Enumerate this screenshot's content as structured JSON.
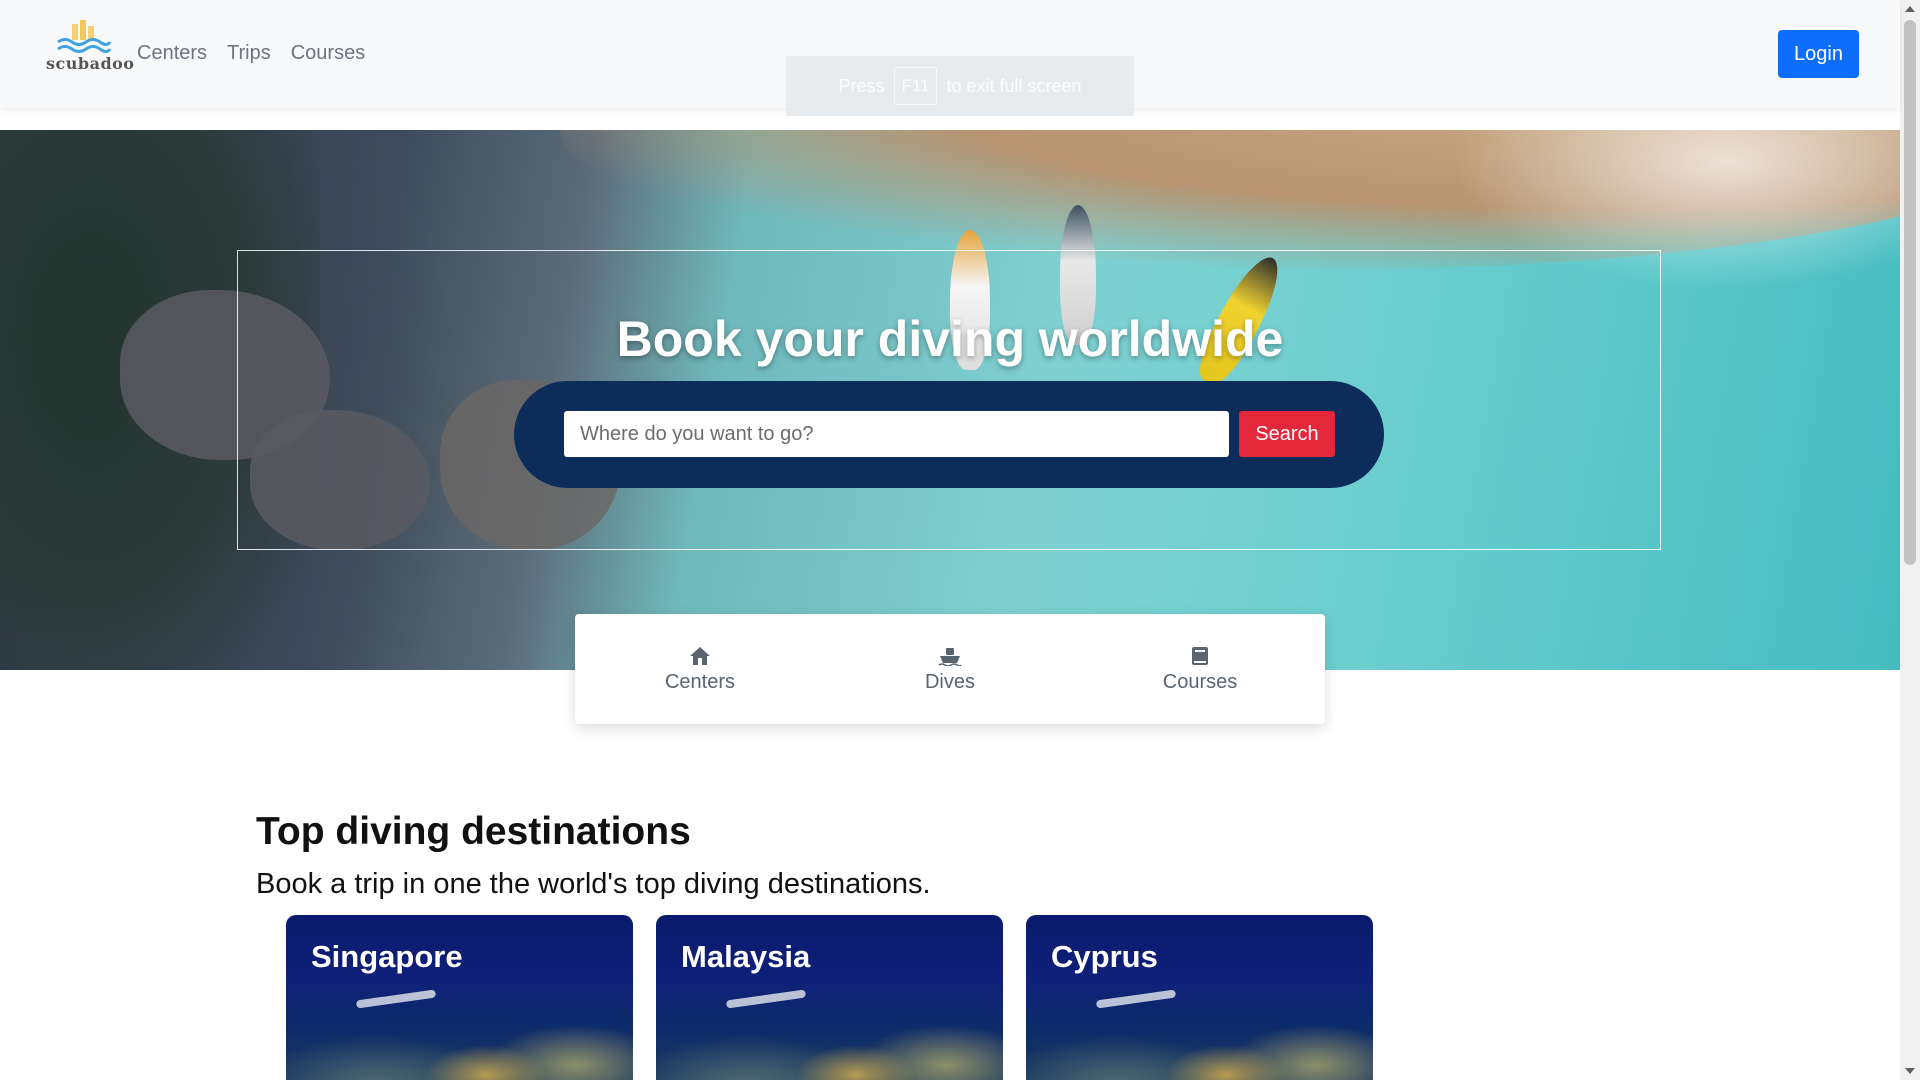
{
  "header": {
    "logo_text": "scubadoo",
    "nav": [
      "Centers",
      "Trips",
      "Courses"
    ],
    "login_label": "Login"
  },
  "fullscreen_notice": {
    "press": "Press",
    "key": "F11",
    "rest": "to exit full screen"
  },
  "hero": {
    "title": "Book your diving worldwide",
    "search_placeholder": "Where do you want to go?",
    "search_button": "Search"
  },
  "tabs": [
    {
      "label": "Centers",
      "icon": "house-icon"
    },
    {
      "label": "Dives",
      "icon": "ship-icon"
    },
    {
      "label": "Courses",
      "icon": "book-icon"
    }
  ],
  "destinations": {
    "title": "Top diving destinations",
    "subtitle": "Book a trip in one the world's top diving destinations.",
    "cards": [
      "Singapore",
      "Malaysia",
      "Cyprus"
    ]
  },
  "colors": {
    "accent": "#0d6efd",
    "search_pill": "#0c2d5a",
    "search_button": "#e4283c"
  }
}
